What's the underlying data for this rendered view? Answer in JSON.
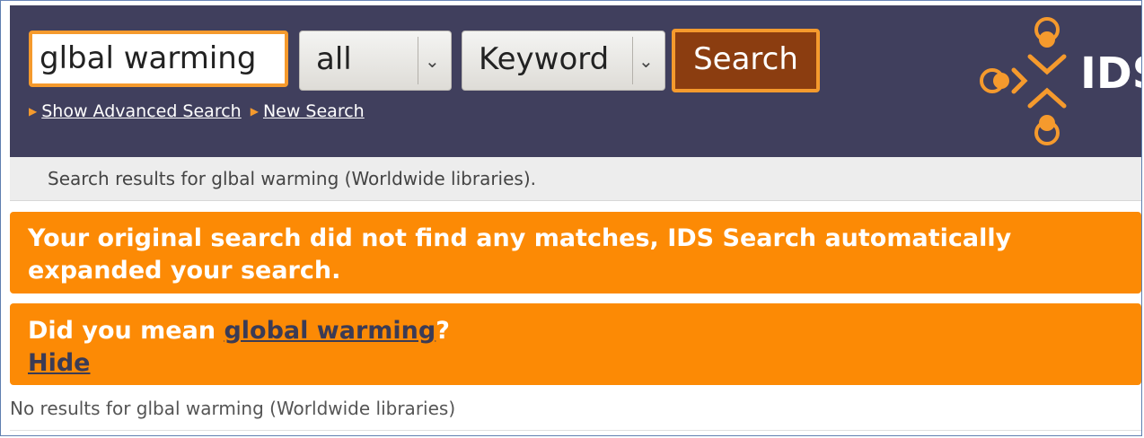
{
  "header": {
    "search_value": "glbal warming",
    "scope_select": "all",
    "type_select": "Keyword",
    "search_button": "Search",
    "advanced_link": "Show Advanced Search",
    "new_search_link": "New Search",
    "logo_text": "IDS"
  },
  "results_bar": {
    "text": "Search results for glbal warming (Worldwide libraries)."
  },
  "notices": {
    "expanded": "Your original search did not find any matches, IDS Search automatically expanded your search.",
    "did_you_mean_prefix": "Did you mean ",
    "suggestion": "global warming",
    "did_you_mean_suffix": "?",
    "hide": "Hide"
  },
  "no_results": "No results for glbal warming (Worldwide libraries)",
  "colors": {
    "header_bg": "#403f5d",
    "accent_orange": "#f59a2d",
    "notice_orange": "#fc8a05",
    "button_brown": "#8b3d10"
  },
  "icons": {
    "select_arrow": "chevron-down-icon",
    "link_bullet": "triangle-right-icon",
    "logo": "ids-logo-icon"
  }
}
